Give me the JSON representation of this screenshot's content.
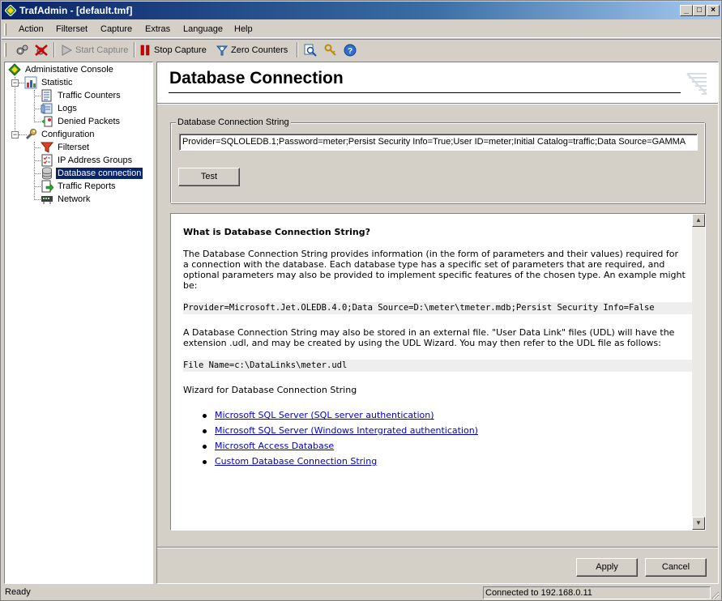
{
  "window": {
    "title": "TrafAdmin - [default.tmf]",
    "minimize": "_",
    "maximize": "□",
    "close": "×"
  },
  "menu": [
    "Action",
    "Filterset",
    "Capture",
    "Extras",
    "Language",
    "Help"
  ],
  "toolbar": {
    "start_capture": "Start Capture",
    "stop_capture": "Stop Capture",
    "zero_counters": "Zero Counters"
  },
  "tree": {
    "root": "Administative Console",
    "statistic": "Statistic",
    "traffic_counters": "Traffic Counters",
    "logs": "Logs",
    "denied_packets": "Denied Packets",
    "configuration": "Configuration",
    "filterset": "Filterset",
    "ip_address_groups": "IP Address Groups",
    "database_connection": "Database connection",
    "traffic_reports": "Traffic Reports",
    "network": "Network",
    "collapse_sign": "−"
  },
  "page": {
    "title": "Database Connection",
    "group_label": "Database Connection String",
    "connection_string": "Provider=SQLOLEDB.1;Password=meter;Persist Security Info=True;User ID=meter;Initial Catalog=traffic;Data Source=GAMMA",
    "test_button": "Test",
    "apply_button": "Apply",
    "cancel_button": "Cancel"
  },
  "help": {
    "heading": "What is Database Connection String?",
    "p1": "The Database Connection String provides information (in the form of parameters and their values) required for a connection with the database. Each database type has a specific set of parameters that are required, and optional parameters may also be provided to implement specific features of the chosen type. An example might be:",
    "code1": "Provider=Microsoft.Jet.OLEDB.4.0;Data Source=D:\\meter\\tmeter.mdb;Persist Security Info=False",
    "p2": "A Database Connection String may also be stored in an external file. \"User Data Link\" files (UDL) will have the extension .udl, and may be created by using the UDL Wizard. You may then refer to the UDL file as follows:",
    "code2": "File Name=c:\\DataLinks\\meter.udl",
    "wizard_title": "Wizard for Database Connection String",
    "links": [
      "Microsoft SQL Server (SQL server authentication)",
      "Microsoft SQL Server (Windows Intergrated authentication)",
      "Microsoft Access Database",
      "Custom Database Connection String"
    ],
    "scroll_up": "▲",
    "scroll_down": "▼"
  },
  "status": {
    "left": "Ready",
    "right": "Connected to 192.168.0.11"
  }
}
